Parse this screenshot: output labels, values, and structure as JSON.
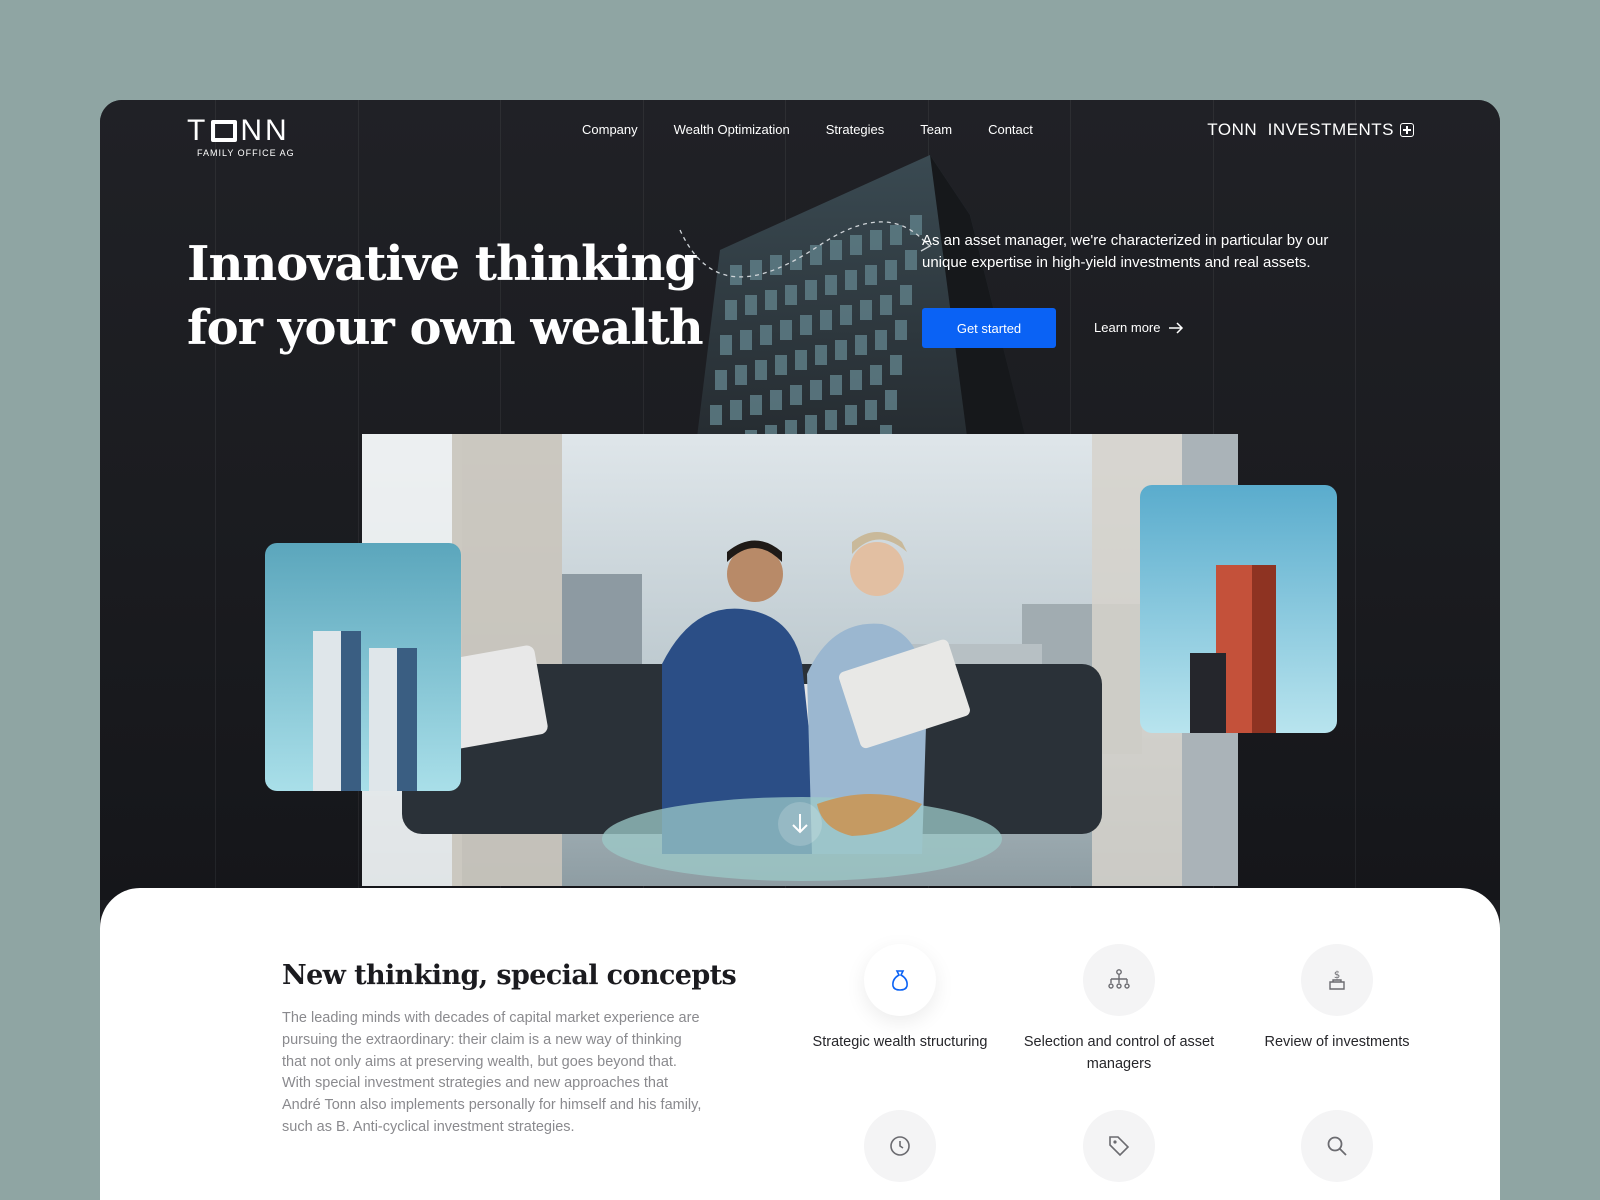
{
  "header": {
    "logo_main_prefix": "T",
    "logo_main_suffix": "NN",
    "logo_sub": "FAMILY OFFICE AG",
    "nav": [
      "Company",
      "Wealth Optimization",
      "Strategies",
      "Team",
      "Contact"
    ],
    "brand_right": "TONN  INVESTMENTS"
  },
  "hero": {
    "headline_line1": "Innovative thinking",
    "headline_line2": "for your own wealth",
    "intro": "As an asset manager, we're characterized in particular by our unique expertise in high-yield investments and real assets.",
    "cta_primary": "Get started",
    "cta_secondary": "Learn more"
  },
  "concepts": {
    "title": "New thinking, special concepts",
    "body": "The leading minds with decades of capital market experience are pursuing the extraordinary: their claim is a new way of thinking that not only aims at preserving wealth, but goes beyond that. With special investment strategies and new approaches that André Tonn also implements personally for himself and his family, such as B. Anti-cyclical investment strategies.",
    "features": [
      {
        "label": "Strategic wealth structuring",
        "icon": "money-bag-icon"
      },
      {
        "label": "Selection and control of asset managers",
        "icon": "org-chart-icon"
      },
      {
        "label": "Review of investments",
        "icon": "dollar-hand-icon"
      },
      {
        "label": "",
        "icon": "clock-icon"
      },
      {
        "label": "",
        "icon": "tag-icon"
      },
      {
        "label": "",
        "icon": "search-icon"
      }
    ]
  },
  "colors": {
    "page_bg": "#8fa5a3",
    "hero_bg": "#1c1d21",
    "accent": "#0a62f5"
  }
}
